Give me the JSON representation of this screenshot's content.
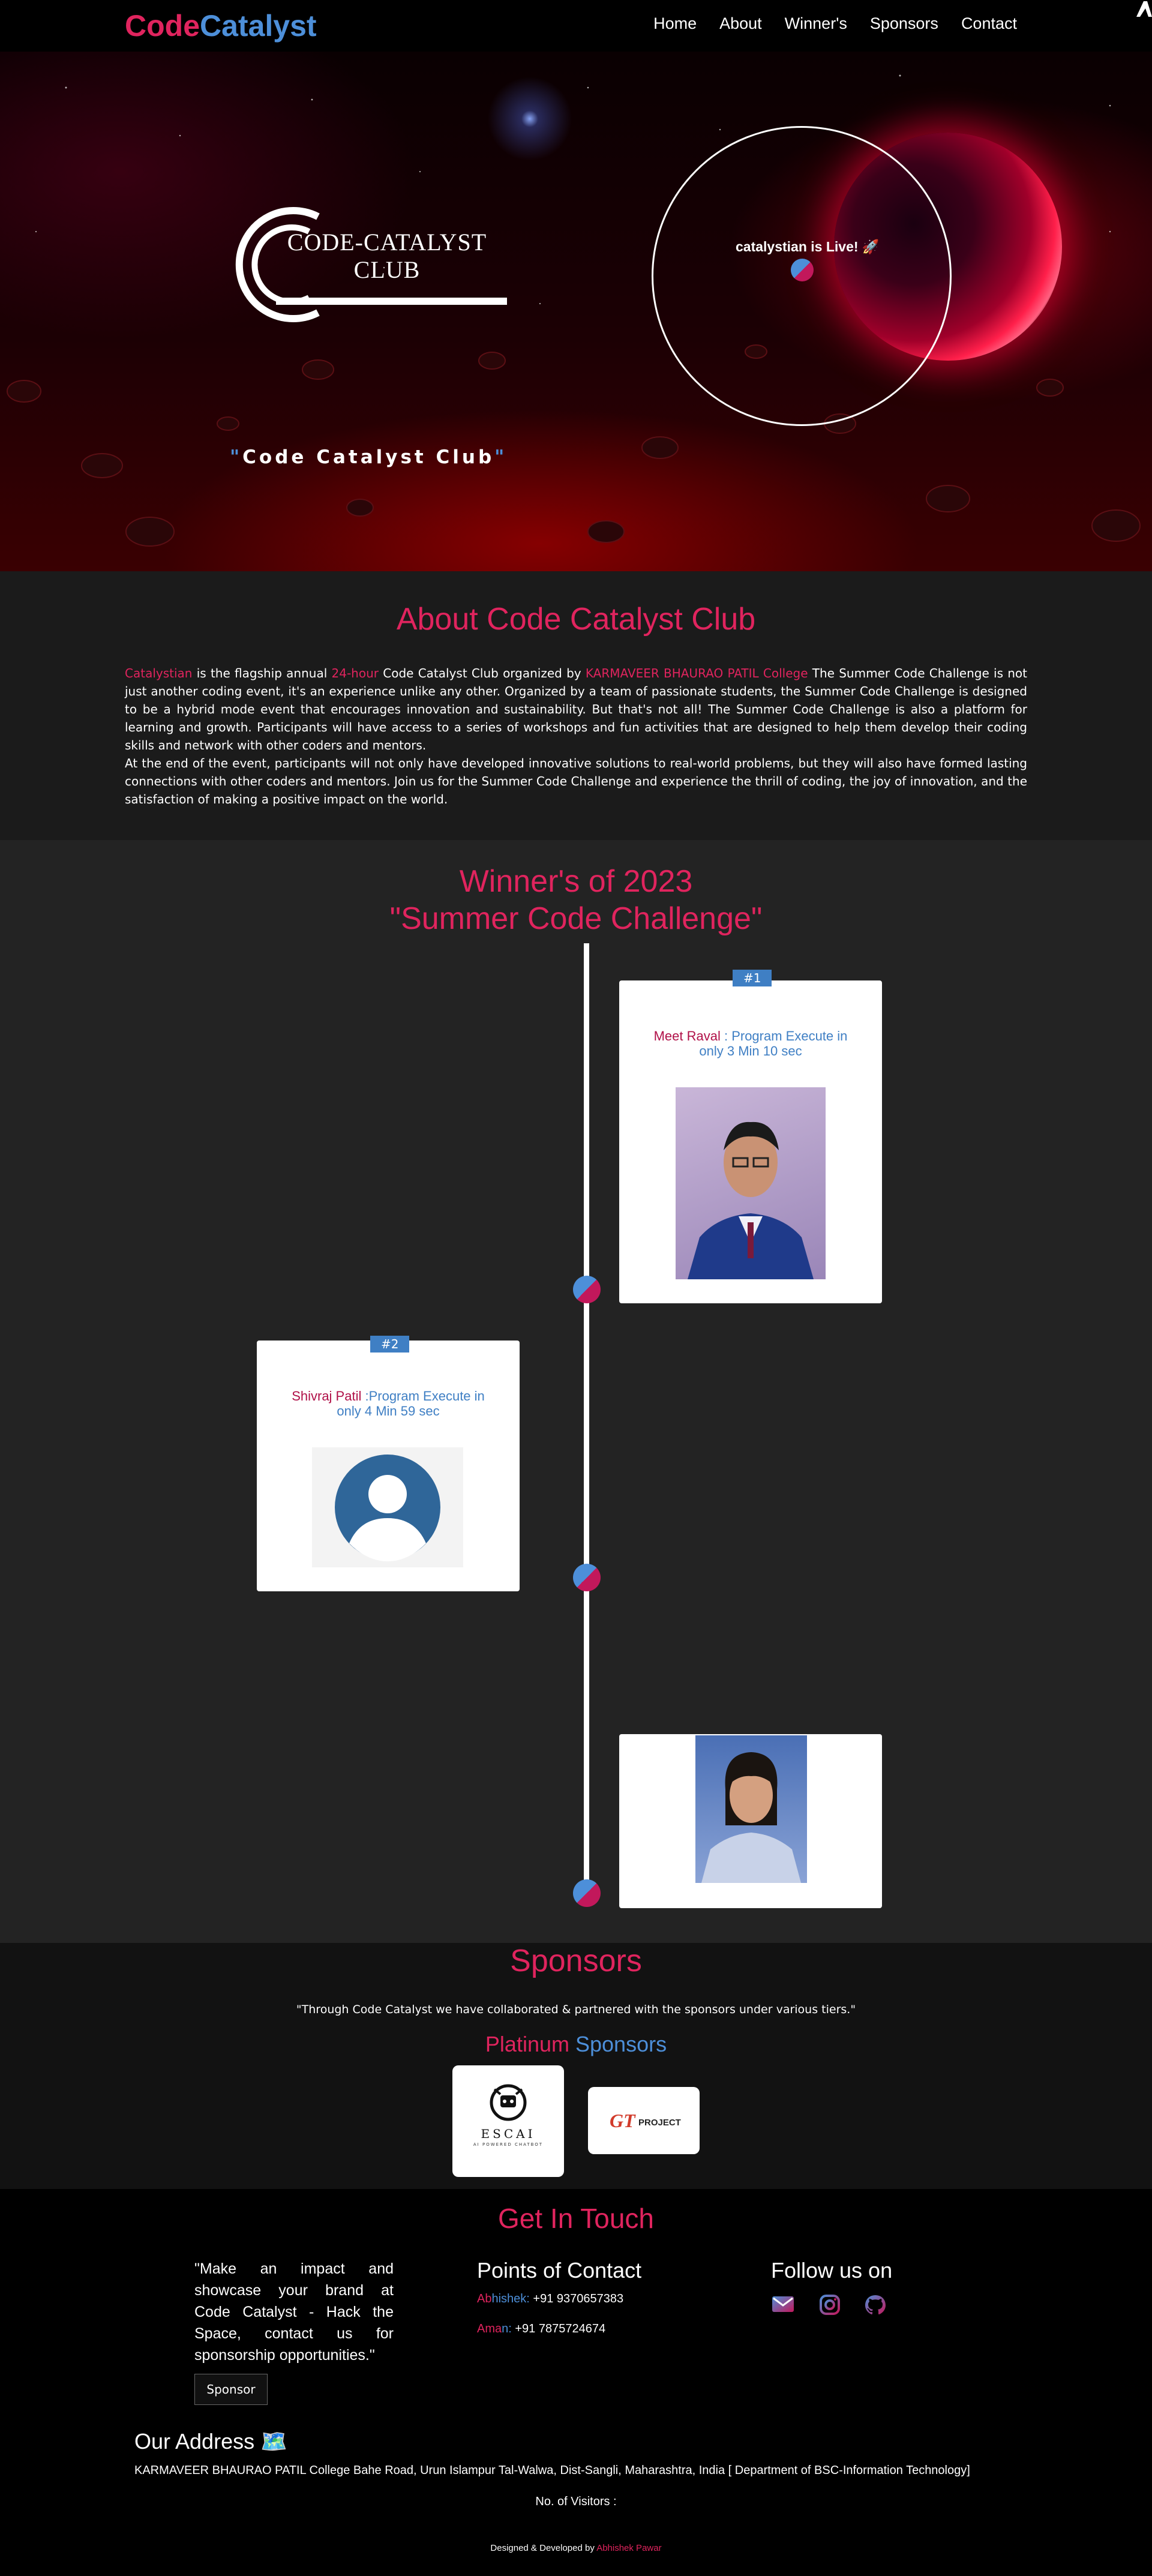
{
  "nav": {
    "logo_part1": "Code",
    "logo_part2": "Catalyst",
    "links": [
      "Home",
      "About",
      "Winner's",
      "Sponsors",
      "Contact"
    ]
  },
  "hero": {
    "club_logo_line1": "CODE-CATALYST",
    "club_logo_line2": "CLUB",
    "live_text": "catalystian is Live! 🚀",
    "quote_open": "\"",
    "quote_text": "Code Catalyst Club",
    "quote_close": "\""
  },
  "about": {
    "title": "About Code Catalyst Club",
    "p1_a": "Catalystian",
    "p1_b": " is the flagship annual ",
    "p1_c": "24-hour",
    "p1_d": " Code Catalyst Club organized by ",
    "p1_e": "KARMAVEER BHAURAO PATIL College",
    "p1_f": " The Summer Code Challenge is not just another coding event, it's an experience unlike any other. Organized by a team of passionate students, the Summer Code Challenge is designed to be a hybrid mode event that encourages innovation and sustainability. But that's not all! The Summer Code Challenge is also a platform for learning and growth. Participants will have access to a series of workshops and fun activities that are designed to help them develop their coding skills and network with other coders and mentors.",
    "p2": "At the end of the event, participants will not only have developed innovative solutions to real-world problems, but they will also have formed lasting connections with other coders and mentors. Join us for the Summer Code Challenge and experience the thrill of coding, the joy of innovation, and the satisfaction of making a positive impact on the world."
  },
  "winners": {
    "title_line1": "Winner's of 2023",
    "title_line2": "\"Summer Code Challenge\"",
    "cards": [
      {
        "badge": "#1",
        "name": "Meet Raval",
        "text": " : Program Execute in only 3 Min 10 sec"
      },
      {
        "badge": "#2",
        "name": "Shivraj Patil",
        "text": " :Program Execute in only 4 Min 59 sec"
      }
    ]
  },
  "sponsors": {
    "title": "Sponsors",
    "quote": "\"Through Code Catalyst we have collaborated & partnered with the sponsors under various tiers.\"",
    "tier_part1": "Platinum",
    "tier_part2": " Sponsors",
    "logo1_main": "ESCAI",
    "logo1_sub": "AI POWERED CHATBOT",
    "logo2_main": "GT",
    "logo2_sub": "PROJECT"
  },
  "contact": {
    "title": "Get In Touch",
    "cta_text": "\"Make an impact and showcase your brand at Code Catalyst - Hack the Space, contact us for sponsorship opportunities.\"",
    "sponsor_button": "Sponsor",
    "poc_title": "Points of Contact",
    "contacts": [
      {
        "name_a": "Ab",
        "name_b": "hishek:",
        "phone": " +91 9370657383"
      },
      {
        "name_a": "Ama",
        "name_b": "n:",
        "phone": " +91 7875724674"
      }
    ],
    "follow_title": "Follow us on",
    "address_title": "Our Address 🗺️",
    "address": "KARMAVEER BHAURAO PATIL College Bahe Road, Urun Islampur Tal-Walwa, Dist-Sangli, Maharashtra, India [ Department of BSC-Information Technology]",
    "visitors": "No. of Visitors :",
    "credits_prefix": "Designed & Developed by ",
    "credits_author": "Abhishek Pawar"
  },
  "colors": {
    "accent_pink": "#e0245e",
    "accent_blue": "#4d8fd9",
    "badge_blue": "#3f7fc4"
  },
  "icons": [
    "email-icon",
    "instagram-icon",
    "github-icon",
    "map-icon",
    "rocket-icon"
  ]
}
